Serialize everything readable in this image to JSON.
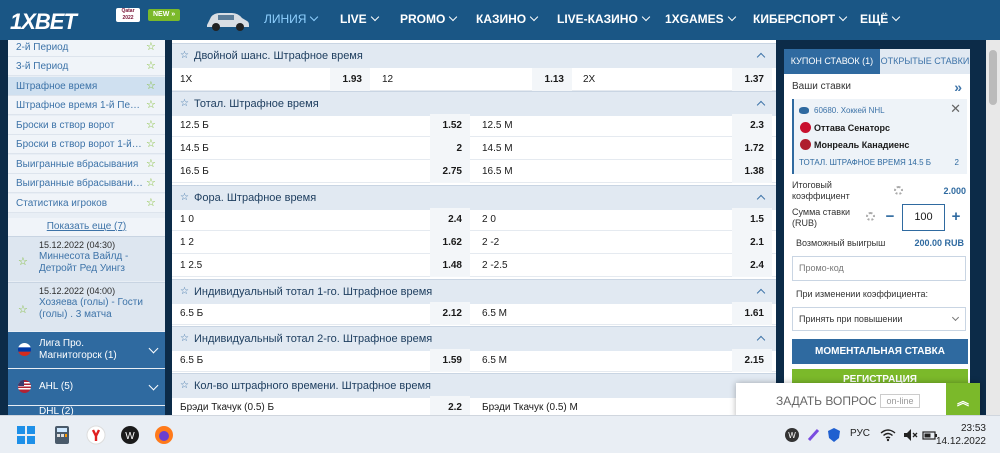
{
  "brand": {
    "logo_text": "1XBET",
    "qatar_badge": "Qatar 2022",
    "new_badge": "NEW »"
  },
  "nav": {
    "items": [
      {
        "label": "ЛИНИЯ"
      },
      {
        "label": "LIVE"
      },
      {
        "label": "PROMO"
      },
      {
        "label": "КАЗИНО"
      },
      {
        "label": "LIVE-КАЗИНО"
      },
      {
        "label": "1XGAMES"
      },
      {
        "label": "КИБЕРСПОРТ"
      },
      {
        "label": "ЕЩЁ"
      }
    ]
  },
  "sidebar": {
    "items": [
      {
        "label": "2-й Период"
      },
      {
        "label": "3-й Период"
      },
      {
        "label": "Штрафное время"
      },
      {
        "label": "Штрафное время 1-й Период"
      },
      {
        "label": "Броски в створ ворот"
      },
      {
        "label": "Броски в створ ворот 1-й П..."
      },
      {
        "label": "Выигранные вбрасывания"
      },
      {
        "label": "Выигранные вбрасывания ..."
      },
      {
        "label": "Статистика игроков"
      }
    ],
    "show_more": "Показать еще (7)",
    "matches": [
      {
        "date": "15.12.2022 (04:30)",
        "teams": "Миннесота Вайлд - Детройт Ред Уингз"
      },
      {
        "date": "15.12.2022 (04:00)",
        "teams": "Хозяева (голы) - Гости (голы) . 3 матча"
      }
    ],
    "leagues": [
      {
        "name": "Лига Про. Магнитогорск",
        "count": "(1)"
      },
      {
        "name": "AHL",
        "count": "(5)"
      },
      {
        "name": "DHL",
        "count": "(2)"
      }
    ]
  },
  "markets": [
    {
      "title": "Двойной шанс. Штрафное время",
      "rows": [
        {
          "cells": [
            {
              "label": "1X",
              "odd": "1.93"
            },
            {
              "label": "12",
              "odd": "1.13"
            },
            {
              "label": "2X",
              "odd": "1.37"
            }
          ]
        }
      ]
    },
    {
      "title": "Тотал. Штрафное время",
      "rows": [
        {
          "cells": [
            {
              "label": "12.5 Б",
              "odd": "1.52"
            },
            {
              "label": "12.5 М",
              "odd": "2.3"
            }
          ]
        },
        {
          "cells": [
            {
              "label": "14.5 Б",
              "odd": "2"
            },
            {
              "label": "14.5 М",
              "odd": "1.72"
            }
          ]
        },
        {
          "cells": [
            {
              "label": "16.5 Б",
              "odd": "2.75"
            },
            {
              "label": "16.5 М",
              "odd": "1.38"
            }
          ]
        }
      ]
    },
    {
      "title": "Фора. Штрафное время",
      "rows": [
        {
          "cells": [
            {
              "label": "1 0",
              "odd": "2.4"
            },
            {
              "label": "2 0",
              "odd": "1.5"
            }
          ]
        },
        {
          "cells": [
            {
              "label": "1 2",
              "odd": "1.62"
            },
            {
              "label": "2 -2",
              "odd": "2.1"
            }
          ]
        },
        {
          "cells": [
            {
              "label": "1 2.5",
              "odd": "1.48"
            },
            {
              "label": "2 -2.5",
              "odd": "2.4"
            }
          ]
        }
      ]
    },
    {
      "title": "Индивидуальный тотал 1-го. Штрафное время",
      "rows": [
        {
          "cells": [
            {
              "label": "6.5 Б",
              "odd": "2.12"
            },
            {
              "label": "6.5 М",
              "odd": "1.61"
            }
          ]
        }
      ]
    },
    {
      "title": "Индивидуальный тотал 2-го. Штрафное время",
      "rows": [
        {
          "cells": [
            {
              "label": "6.5 Б",
              "odd": "1.59"
            },
            {
              "label": "6.5 М",
              "odd": "2.15"
            }
          ]
        }
      ]
    },
    {
      "title": "Кол-во штрафного времени. Штрафное время",
      "rows": [
        {
          "cells": [
            {
              "label": "Брэди Ткачук (0.5) Б",
              "odd": "2.2"
            },
            {
              "label": "Брэди Ткачук (0.5) М",
              "odd": ""
            }
          ]
        }
      ]
    }
  ],
  "coupon": {
    "tab_coupon": "КУПОН СТАВОК (1)",
    "tab_open": "ОТКРЫТЫЕ СТАВКИ",
    "your_bets": "Ваши ставки",
    "event": "60680. Хоккей NHL",
    "team1": "Оттава Сенаторс",
    "team2": "Монреаль Канадиенс",
    "selection": "ТОТАЛ. ШТРАФНОЕ ВРЕМЯ 14.5 Б",
    "selection_odd": "2",
    "total_coef_label": "Итоговый коэффициент",
    "total_coef": "2.000",
    "stake_label": "Сумма ставки (RUB)",
    "stake_value": "100",
    "win_label": "Возможный выигрыш",
    "win_value": "200.00 RUB",
    "promo_placeholder": "Промо-код",
    "odds_change_label": "При изменении коэффициента:",
    "odds_change_value": "Принять при повышении",
    "instant_bet": "МОМЕНТАЛЬНАЯ СТАВКА",
    "register": "РЕГИСТРАЦИЯ"
  },
  "ask": {
    "label": "ЗАДАТЬ ВОПРОС",
    "status": "on-line"
  },
  "taskbar": {
    "lang": "РУС",
    "time": "23:53",
    "date": "14.12.2022"
  },
  "colors": {
    "nav": "#1a5685",
    "accent": "#2f6aa0",
    "green": "#7bb92a"
  }
}
